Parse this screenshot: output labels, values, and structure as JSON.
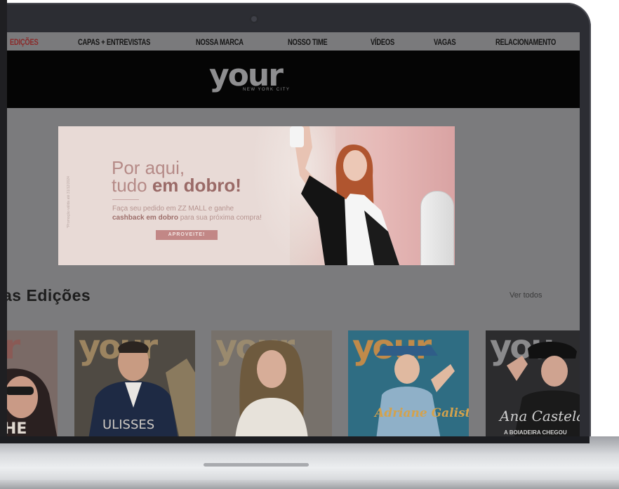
{
  "nav": {
    "items": [
      "EDIÇÕES",
      "CAPAS + ENTREVISTAS",
      "NOSSA MARCA",
      "NOSSO TIME",
      "VÍDEOS",
      "VAGAS",
      "RELACIONAMENTO"
    ],
    "active_index": 0
  },
  "header": {
    "logo_text": "your",
    "logo_subtitle": "NEW YORK CITY"
  },
  "banner": {
    "headline_line1": "Por aqui,",
    "headline_line2_prefix": "tudo ",
    "headline_line2_bold": "em dobro!",
    "sub_line1": "Faça seu pedido em ZZ MALL e ganhe",
    "sub_line2_bold": "cashback em dobro",
    "sub_line2_rest": " para sua próxima compra!",
    "button_label": "APROVEITE!",
    "vertical_note": "*Promoção válida até 31/12/2024"
  },
  "editions": {
    "title": "as Edições",
    "see_all_label": "Ver todos",
    "covers": [
      {
        "logo": "your",
        "name": "HE",
        "bg": "#7a6a66",
        "logo_color": "#8a5a55"
      },
      {
        "logo": "your",
        "name": "ULISSES",
        "bg": "#4f4a43",
        "logo_color": "#9c8460"
      },
      {
        "logo": "your",
        "name": "",
        "bg": "#77716b",
        "logo_color": "#9a8a6e"
      },
      {
        "logo": "your",
        "name": "Adriane Galisteu",
        "bg": "#2f6d83",
        "logo_color": "#c08a4a"
      },
      {
        "logo": "you",
        "name": "Ana Castela",
        "sub": "A BOIADEIRA CHEGOU",
        "bg": "#2c2c2e",
        "logo_color": "#8a8a8c"
      }
    ]
  },
  "colors": {
    "nav_bg": "#7a7a7c",
    "header_bg": "#050505",
    "page_bg": "#7b7b7d",
    "accent": "#8a2a2a",
    "banner_button": "#c28786"
  }
}
